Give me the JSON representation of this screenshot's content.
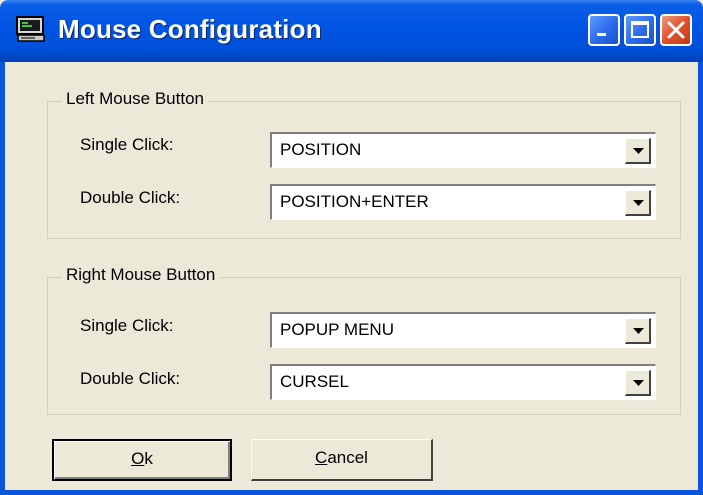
{
  "window": {
    "title": "Mouse Configuration",
    "title_bar_color": "#0054E3",
    "close_button_color": "#E0502C"
  },
  "left_group": {
    "legend": "Left Mouse Button",
    "single_click_label": "Single Click:",
    "single_click_value": "POSITION",
    "double_click_label": "Double Click:",
    "double_click_value": "POSITION+ENTER"
  },
  "right_group": {
    "legend": "Right Mouse Button",
    "single_click_label": "Single Click:",
    "single_click_value": "POPUP MENU",
    "double_click_label": "Double Click:",
    "double_click_value": "CURSEL"
  },
  "buttons": {
    "ok_mnemonic": "O",
    "ok_rest": "k",
    "cancel_mnemonic": "C",
    "cancel_rest": "ancel"
  }
}
